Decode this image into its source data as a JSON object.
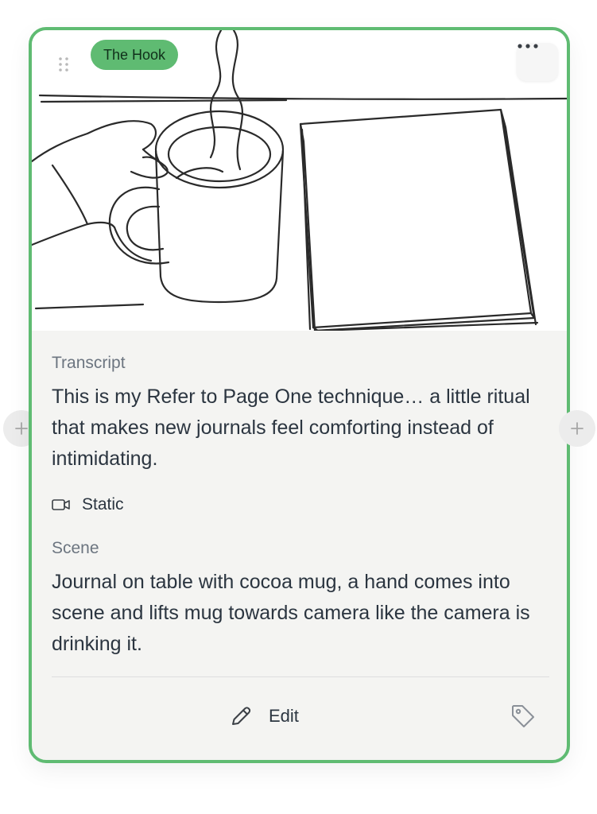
{
  "card": {
    "label": "The Hook",
    "more_icon": "more-horizontal-icon",
    "drag_icon": "drag-handle-icon",
    "accent_color": "#5fbb72",
    "image": {
      "description_icon": "sketch-image"
    },
    "transcript": {
      "heading": "Transcript",
      "text": "This is my Refer to Page One technique… a little ritual that makes new journals feel comforting instead of intimidating."
    },
    "camera": {
      "icon": "video-camera-icon",
      "value": "Static"
    },
    "scene": {
      "heading": "Scene",
      "text": "Journal on table with cocoa mug, a hand comes into scene and lifts mug towards camera like the camera is drinking it."
    },
    "footer": {
      "edit_label": "Edit",
      "edit_icon": "pencil-icon",
      "tag_icon": "tag-icon"
    }
  },
  "side_buttons": {
    "left_icon": "plus-icon",
    "right_icon": "plus-icon"
  }
}
